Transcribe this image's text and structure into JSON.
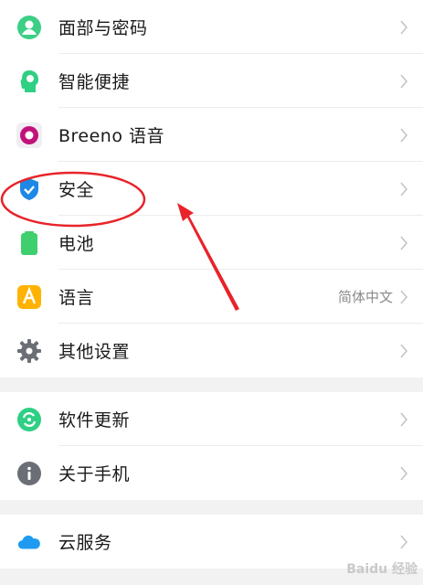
{
  "settings": {
    "group1": [
      {
        "label": "面部与密码",
        "icon": "face-password-icon",
        "value": ""
      },
      {
        "label": "智能便捷",
        "icon": "smart-convenience-icon",
        "value": ""
      },
      {
        "label": "Breeno 语音",
        "icon": "breeno-voice-icon",
        "value": ""
      },
      {
        "label": "安全",
        "icon": "security-shield-icon",
        "value": ""
      },
      {
        "label": "电池",
        "icon": "battery-icon",
        "value": ""
      },
      {
        "label": "语言",
        "icon": "language-icon",
        "value": "简体中文"
      },
      {
        "label": "其他设置",
        "icon": "gear-icon",
        "value": ""
      }
    ],
    "group2": [
      {
        "label": "软件更新",
        "icon": "software-update-icon",
        "value": ""
      },
      {
        "label": "关于手机",
        "icon": "about-phone-icon",
        "value": ""
      }
    ],
    "group3": [
      {
        "label": "云服务",
        "icon": "cloud-icon",
        "value": ""
      }
    ]
  },
  "watermark": "Baidu 经验",
  "colors": {
    "annotation": "#e8232a",
    "accent_blue": "#1e88e5",
    "green": "#3fcf6e"
  }
}
